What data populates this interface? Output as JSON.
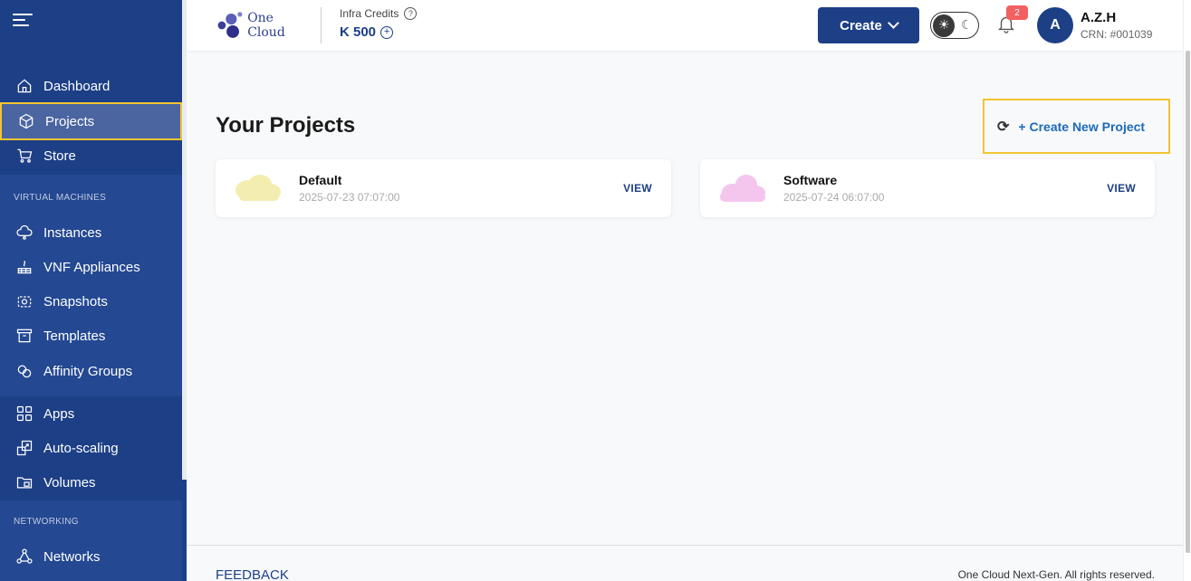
{
  "sidebar": {
    "items": [
      {
        "label": "Dashboard"
      },
      {
        "label": "Projects"
      },
      {
        "label": "Store"
      },
      {
        "label": "Instances"
      },
      {
        "label": "VNF Appliances"
      },
      {
        "label": "Snapshots"
      },
      {
        "label": "Templates"
      },
      {
        "label": "Affinity Groups"
      },
      {
        "label": "Apps"
      },
      {
        "label": "Auto-scaling"
      },
      {
        "label": "Volumes"
      },
      {
        "label": "Networks"
      }
    ],
    "sections": {
      "virtual_machines": "VIRTUAL MACHINES",
      "networking": "NETWORKING"
    },
    "active": "Projects"
  },
  "header": {
    "logo_text": "One Cloud",
    "credits_label": "Infra Credits",
    "credits_value": "K 500",
    "create_label": "Create",
    "notification_count": "2",
    "user": {
      "initial": "A",
      "name": "A.Z.H",
      "crn": "CRN: #001039"
    }
  },
  "main": {
    "title": "Your Projects",
    "create_project_label": "+ Create New Project",
    "projects": [
      {
        "name": "Default",
        "date": "2025-07-23 07:07:00",
        "action": "VIEW",
        "cloud_color": "#f3eeb0"
      },
      {
        "name": "Software",
        "date": "2025-07-24 06:07:00",
        "action": "VIEW",
        "cloud_color": "#f4c6ee"
      }
    ]
  },
  "footer": {
    "feedback": "FEEDBACK",
    "copyright": "One Cloud Next-Gen. All rights reserved."
  },
  "colors": {
    "sidebar": "#1d3f86",
    "accent": "#f4c430",
    "link": "#1d6ab8"
  }
}
